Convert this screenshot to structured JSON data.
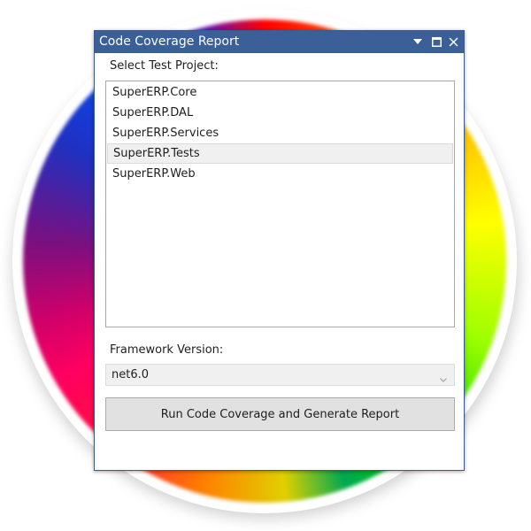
{
  "window": {
    "title": "Code Coverage Report",
    "controls": {
      "menu_icon": "dropdown-triangle-icon",
      "maximize_icon": "maximize-icon",
      "close_icon": "close-icon"
    }
  },
  "project": {
    "label": "Select Test Project:",
    "items": [
      {
        "label": "SuperERP.Core",
        "selected": false
      },
      {
        "label": "SuperERP.DAL",
        "selected": false
      },
      {
        "label": "SuperERP.Services",
        "selected": false
      },
      {
        "label": "SuperERP.Tests",
        "selected": true
      },
      {
        "label": "SuperERP.Web",
        "selected": false
      }
    ]
  },
  "framework": {
    "label": "Framework Version:",
    "selected": "net6.0"
  },
  "actions": {
    "run_label": "Run Code Coverage and Generate Report"
  },
  "colors": {
    "titlebar": "#3b5f99",
    "selection": "#f0f0f0",
    "button": "#e1e1e1"
  }
}
